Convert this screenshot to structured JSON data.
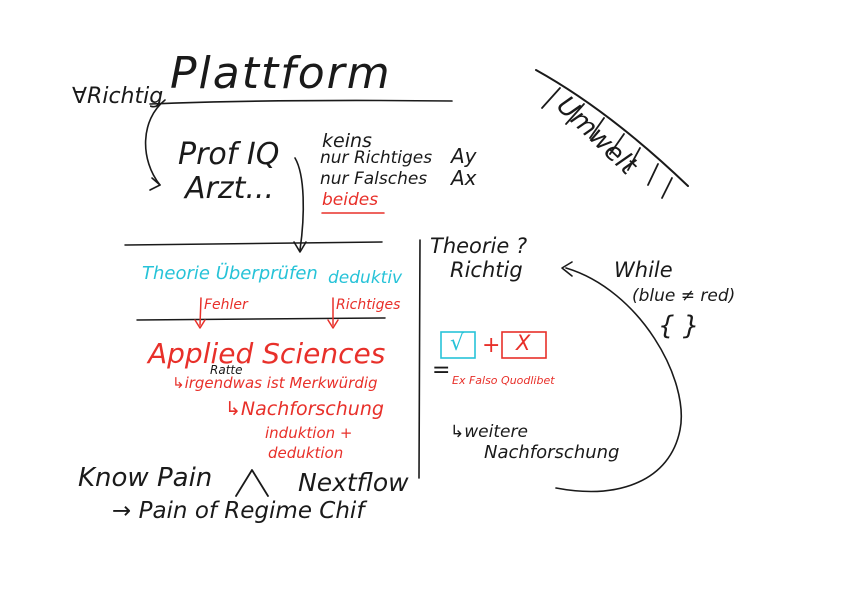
{
  "header": {
    "forall_richtig": "∀Richtig",
    "title": "Plattform",
    "umwelt": "Umwelt"
  },
  "middle": {
    "prof_iq": "Prof IQ",
    "arzt": "Arzt...",
    "options": [
      "keins",
      "nur Richtiges",
      "nur Falsches",
      "beides"
    ],
    "a_y": "Ay",
    "a_x": "Ax"
  },
  "left_block": {
    "theory_check": "Theorie Überprüfen",
    "deduktiv": "deduktiv",
    "fehler": "Fehler",
    "richtiges": "Richtiges",
    "applied_sciences": "Applied Sciences",
    "ratte": "Ratte",
    "irgendwas": "↳irgendwas ist Merkwürdig",
    "nachforschung": "↳Nachforschung",
    "induktion": "induktion +",
    "deduktion": "deduktion"
  },
  "right_block": {
    "theorie": "Theorie ?",
    "richtig": "Richtig",
    "while": "While",
    "blue_red": "(blue ≠ red)",
    "braces": "{ }",
    "check_symbol": "√",
    "plus": "+",
    "x_symbol": "X",
    "equals": "=",
    "ex_falso": "Ex Falso Quodlibet",
    "weitere": "↳weitere",
    "nachforschung2": "Nachforschung"
  },
  "bottom": {
    "know_pain": "Know Pain",
    "caret": "^",
    "nextflow": "Nextflow",
    "pain_of_regime": "→ Pain of Regime Chif"
  },
  "colors": {
    "black": "#1a1a1a",
    "red": "#e8302a",
    "cyan": "#27c3d8"
  }
}
